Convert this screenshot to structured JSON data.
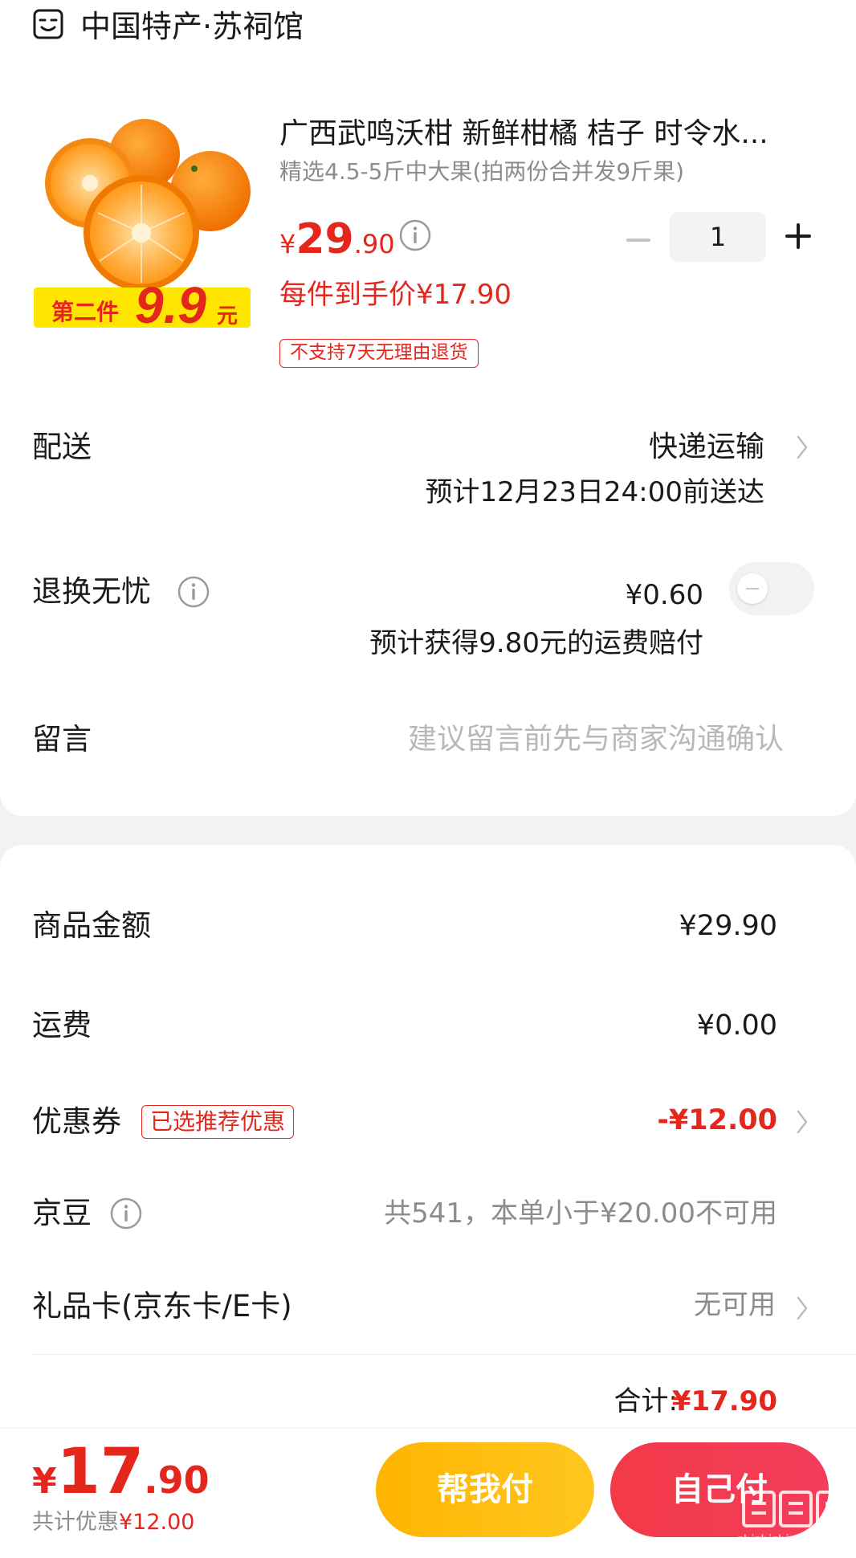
{
  "shop": {
    "name": "中国特产·苏祠馆",
    "icon": "shop-icon"
  },
  "product": {
    "image_badge_prefix": "第二件",
    "image_badge_value": "9.9",
    "image_badge_suffix": "元",
    "title": "广西武鸣沃柑 新鲜柑橘 桔子 时令水...",
    "spec": "精选4.5-5斤中大果(拍两份合并发9斤果)",
    "price_symbol": "¥",
    "price_int": "29",
    "price_dec": ".90",
    "quantity": "1",
    "hand_price": "每件到手价¥17.90",
    "return_tag": "不支持7天无理由退货"
  },
  "delivery": {
    "label": "配送",
    "method": "快递运输",
    "eta": "预计12月23日24:00前送达"
  },
  "worry_free": {
    "label": "退换无忧",
    "price": "¥0.60",
    "desc": "预计获得9.80元的运费赔付",
    "enabled": false
  },
  "message": {
    "label": "留言",
    "placeholder": "建议留言前先与商家沟通确认"
  },
  "summary": {
    "goods_label": "商品金额",
    "goods_value": "¥29.90",
    "shipping_label": "运费",
    "shipping_value": "¥0.00",
    "coupon_label": "优惠券",
    "coupon_badge": "已选推荐优惠",
    "coupon_value": "-¥12.00",
    "beans_label": "京豆",
    "beans_value": "共541，本单小于¥20.00不可用",
    "giftcard_label": "礼品卡(京东卡/E卡)",
    "giftcard_value": "无可用",
    "total_label": "合计:",
    "total_value": "¥17.90"
  },
  "bottom": {
    "yen": "¥",
    "total_int": "17",
    "total_dec": ".90",
    "saved_label": "共计优惠",
    "saved_value": "¥12.00",
    "help_pay": "帮我付",
    "self_pay": "自己付"
  },
  "watermark": {
    "text": "zhizhizhi.com"
  },
  "colors": {
    "accent": "#e4261c",
    "help_btn": "#ffb400",
    "self_btn": "#f23a48"
  }
}
